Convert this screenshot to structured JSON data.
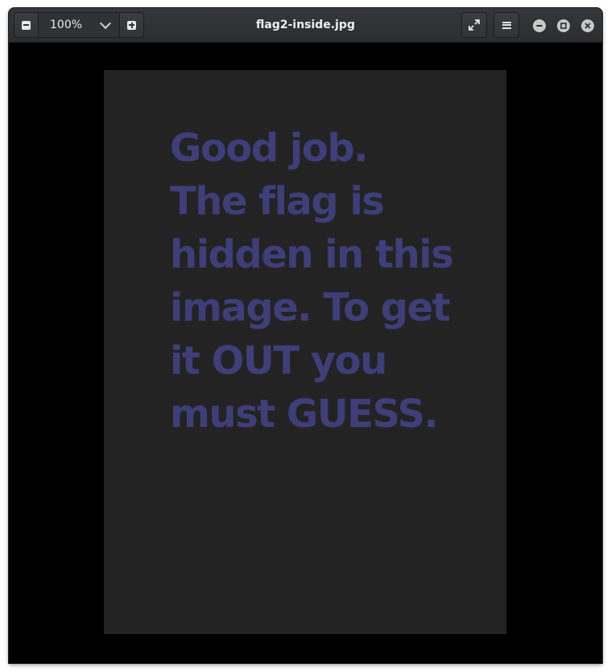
{
  "window": {
    "title": "flag2-inside.jpg"
  },
  "zoom": {
    "value": "100%"
  },
  "icons": {
    "zoom_out": "minus-square-icon",
    "zoom_in": "plus-square-icon",
    "zoom_dropdown": "chevron-down-icon",
    "fullscreen": "expand-icon",
    "menu": "hamburger-icon",
    "minimize": "minimize-icon",
    "maximize": "maximize-icon",
    "close": "close-icon"
  },
  "image": {
    "background_color": "#232323",
    "text_color": "#3e3e79",
    "lines": [
      "Good job.",
      "The flag is",
      "hidden in this",
      "image. To get",
      "it OUT you",
      "must GUESS."
    ]
  }
}
